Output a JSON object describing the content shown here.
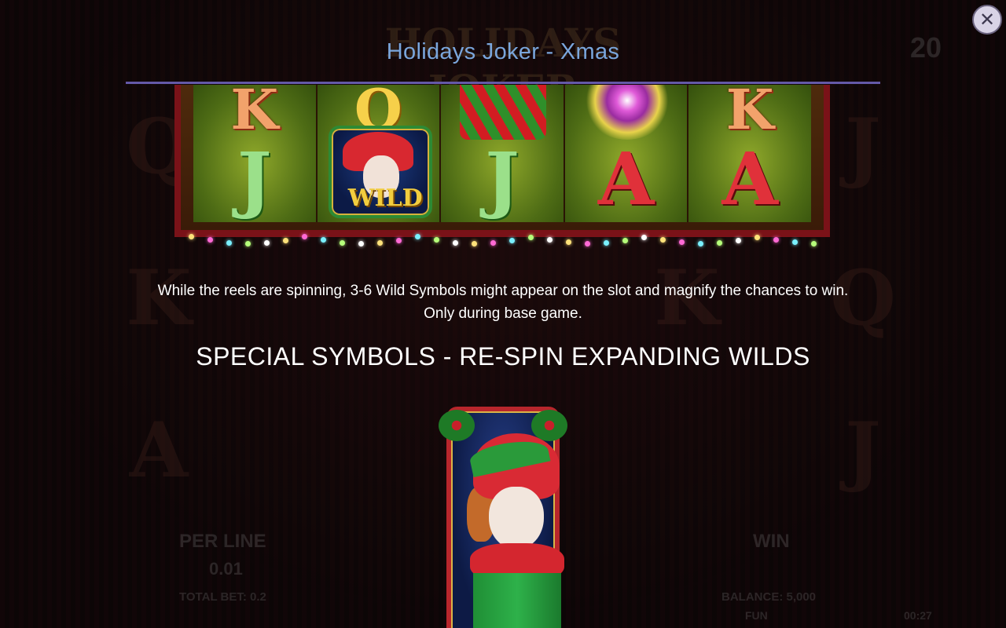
{
  "modal": {
    "title": "Holidays Joker - Xmas",
    "close_icon": "close-icon"
  },
  "reel_example": {
    "columns": [
      {
        "top": "K",
        "bottom": "J"
      },
      {
        "top": "Q",
        "bottom": "WILD"
      },
      {
        "top": "gift",
        "bottom": "J"
      },
      {
        "top": "firework",
        "bottom": "A"
      },
      {
        "top": "K",
        "bottom": "A"
      }
    ],
    "wild_label": "WILD"
  },
  "description": {
    "line1": "While the reels are spinning, 3-6 Wild Symbols might appear on the slot and magnify the chances to win.",
    "line2": "Only during base game."
  },
  "section": {
    "heading": "SPECIAL SYMBOLS - RE-SPIN EXPANDING WILDS"
  },
  "background_game": {
    "title": "HOLIDAYS JOKER",
    "lines_value": "20",
    "per_line_label": "PER LINE",
    "per_line_value": "0.01",
    "total_bet": "TOTAL BET: 0.2",
    "win_label": "WIN",
    "balance": "BALANCE: 5,000",
    "mode": "FUN",
    "clock": "00:27"
  },
  "colors": {
    "title": "#7aa6dc",
    "rule": "#6459a8",
    "background": "#0a0607"
  }
}
